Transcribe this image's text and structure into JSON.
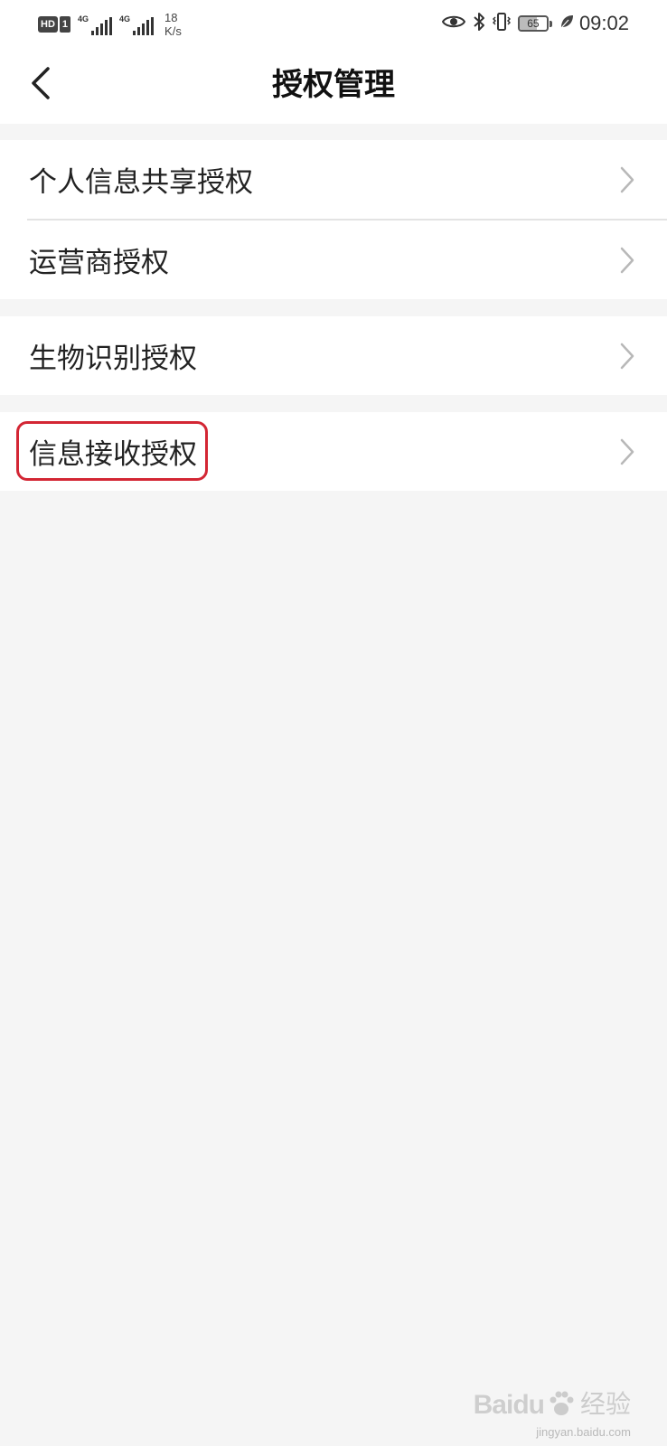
{
  "status_bar": {
    "hd_badge": "HD",
    "sim_number": "1",
    "network_1": "4G",
    "network_2": "4G",
    "speed_value": "18",
    "speed_unit": "K/s",
    "battery_level": "65",
    "battery_fraction": 0.65,
    "time": "09:02",
    "icons": [
      "eye-icon",
      "bluetooth-icon",
      "vibrate-icon",
      "battery-icon",
      "leaf-icon"
    ]
  },
  "header": {
    "title": "授权管理",
    "back_icon": "chevron-left-icon"
  },
  "groups": [
    {
      "items": [
        {
          "label": "个人信息共享授权"
        },
        {
          "label": "运营商授权"
        }
      ]
    },
    {
      "items": [
        {
          "label": "生物识别授权"
        }
      ]
    },
    {
      "items": [
        {
          "label": "信息接收授权",
          "highlighted": true
        }
      ]
    }
  ],
  "highlight_color": "#d32634",
  "background_color": "#f5f5f5",
  "watermark": {
    "brand": "Baidu",
    "sub": "经验",
    "url": "jingyan.baidu.com"
  }
}
